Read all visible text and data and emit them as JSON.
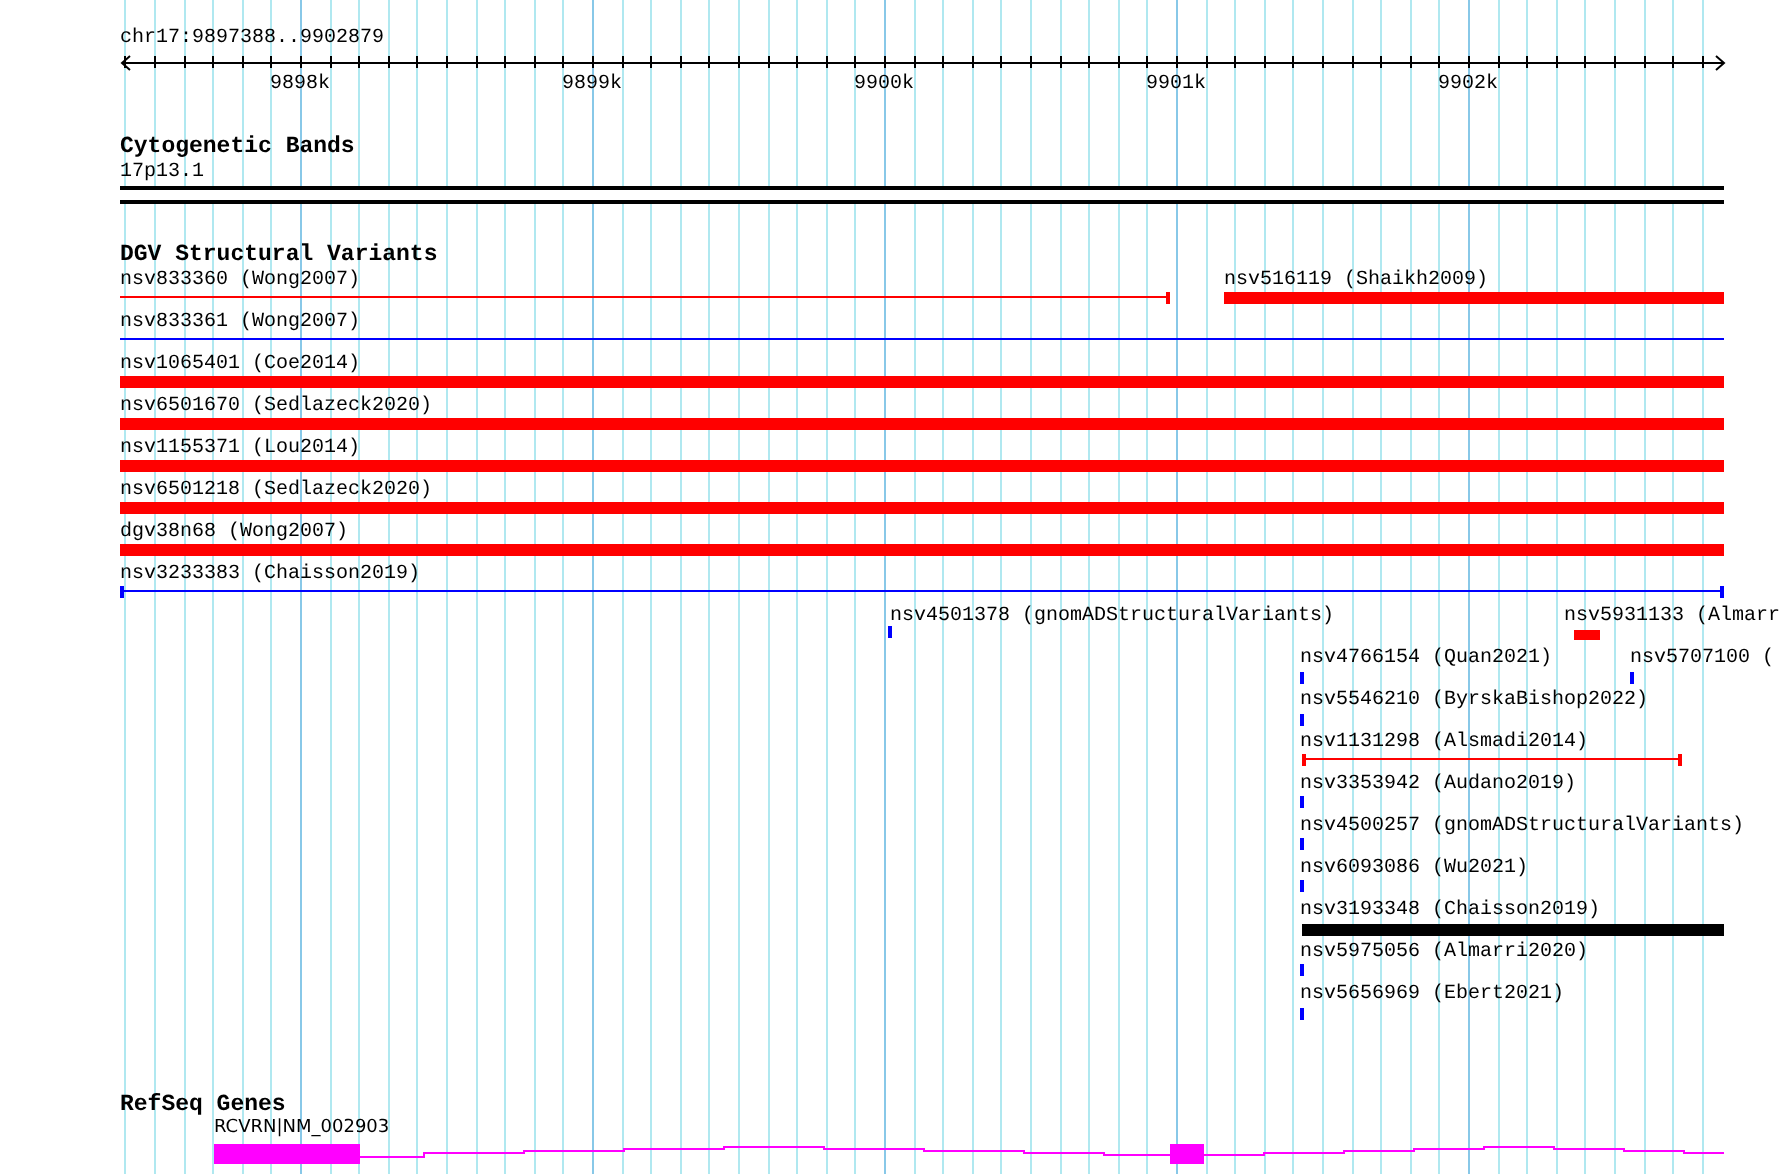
{
  "ruler": {
    "location": "chr17:9897388..9902879",
    "ticks": [
      "9898k",
      "9899k",
      "9900k",
      "9901k",
      "9902k"
    ]
  },
  "tracks": [
    {
      "title": "Cytogenetic Bands",
      "kind": "bands",
      "features": [
        {
          "label": "17p13.1",
          "color": "#000000"
        }
      ]
    },
    {
      "title": "DGV Structural Variants",
      "kind": "variants",
      "features": [
        {
          "label": "nsv833360 (Wong2007)",
          "kind": "thin",
          "color": "#ff0000"
        },
        {
          "label": "nsv516119 (Shaikh2009)",
          "kind": "thick",
          "color": "#ff0000"
        },
        {
          "label": "nsv833361 (Wong2007)",
          "kind": "thin",
          "color": "#0000ff"
        },
        {
          "label": "nsv1065401 (Coe2014)",
          "kind": "thick",
          "color": "#ff0000"
        },
        {
          "label": "nsv6501670 (Sedlazeck2020)",
          "kind": "thick",
          "color": "#ff0000"
        },
        {
          "label": "nsv1155371 (Lou2014)",
          "kind": "thick",
          "color": "#ff0000"
        },
        {
          "label": "nsv6501218 (Sedlazeck2020)",
          "kind": "thick",
          "color": "#ff0000"
        },
        {
          "label": "dgv38n68 (Wong2007)",
          "kind": "thick",
          "color": "#ff0000"
        },
        {
          "label": "nsv3233383 (Chaisson2019)",
          "kind": "thin",
          "color": "#0000ff"
        },
        {
          "label": "nsv4501378 (gnomADStructuralVariants)",
          "kind": "mark",
          "color": "#0000ff"
        },
        {
          "label": "nsv5931133 (Almarr",
          "kind": "thick",
          "color": "#ff0000"
        },
        {
          "label": "nsv4766154 (Quan2021)",
          "kind": "mark",
          "color": "#0000ff"
        },
        {
          "label": "nsv5707100 (",
          "kind": "mark",
          "color": "#0000ff"
        },
        {
          "label": "nsv5546210 (ByrskaBishop2022)",
          "kind": "mark",
          "color": "#0000ff"
        },
        {
          "label": "nsv1131298 (Alsmadi2014)",
          "kind": "thin",
          "color": "#ff0000"
        },
        {
          "label": "nsv3353942 (Audano2019)",
          "kind": "mark",
          "color": "#0000ff"
        },
        {
          "label": "nsv4500257 (gnomADStructuralVariants)",
          "kind": "mark",
          "color": "#0000ff"
        },
        {
          "label": "nsv6093086 (Wu2021)",
          "kind": "mark",
          "color": "#0000ff"
        },
        {
          "label": "nsv3193348 (Chaisson2019)",
          "kind": "thick",
          "color": "#000000"
        },
        {
          "label": "nsv5975056 (Almarri2020)",
          "kind": "mark",
          "color": "#0000ff"
        },
        {
          "label": "nsv5656969 (Ebert2021)",
          "kind": "mark",
          "color": "#0000ff"
        }
      ]
    },
    {
      "title": "RefSeq Genes",
      "kind": "genes",
      "features": [
        {
          "label": "RCVRN|NM_002903",
          "color": "#ff00ff"
        }
      ]
    }
  ]
}
